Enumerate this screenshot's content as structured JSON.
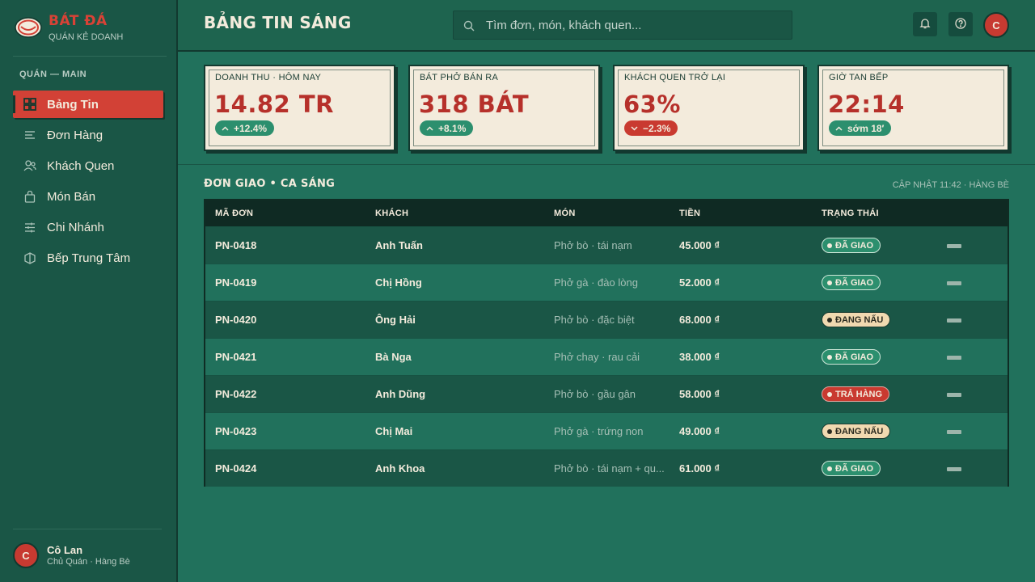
{
  "brand": {
    "name": "BÁT ĐÁ",
    "subtitle": "QUÁN KẺ DOANH"
  },
  "sidebar": {
    "section_label": "QUÁN — MAIN",
    "items": [
      {
        "label": "Bảng Tin",
        "icon": "dashboard-icon",
        "active": true
      },
      {
        "label": "Đơn Hàng",
        "icon": "list-icon",
        "active": false
      },
      {
        "label": "Khách Quen",
        "icon": "users-icon",
        "active": false
      },
      {
        "label": "Món Bán",
        "icon": "bag-icon",
        "active": false
      },
      {
        "label": "Chi Nhánh",
        "icon": "branch-icon",
        "active": false
      },
      {
        "label": "Bếp Trung Tâm",
        "icon": "cube-icon",
        "active": false
      }
    ],
    "user": {
      "initial": "C",
      "name": "Cô Lan",
      "role": "Chủ Quán · Hàng Bè"
    }
  },
  "header": {
    "title": "BẢNG TIN SÁNG",
    "search_placeholder": "Tìm đơn, món, khách quen...",
    "avatar_initial": "C"
  },
  "stats": [
    {
      "label": "DOANH THU · HÔM NAY",
      "value": "14.82 TR",
      "delta": "+12.4%",
      "direction": "up"
    },
    {
      "label": "BÁT PHỞ BÁN RA",
      "value": "318 BÁT",
      "delta": "+8.1%",
      "direction": "up"
    },
    {
      "label": "KHÁCH QUEN TRỞ LẠI",
      "value": "63%",
      "delta": "−2.3%",
      "direction": "down"
    },
    {
      "label": "GIỜ TAN BẾP",
      "value": "22:14",
      "delta": "sớm 18′",
      "direction": "up"
    }
  ],
  "orders": {
    "title": "ĐƠN GIAO • CA SÁNG",
    "meta": "CẬP NHẬT 11:42 · HÀNG BÈ",
    "columns": [
      "MÃ ĐƠN",
      "KHÁCH",
      "MÓN",
      "TIỀN",
      "TRẠNG THÁI"
    ],
    "rows": [
      {
        "id": "PN-0418",
        "customer": "Anh Tuấn",
        "dish": "Phở bò · tái nạm",
        "price": "45.000 ₫",
        "status": "ĐÃ GIAO",
        "status_type": "done"
      },
      {
        "id": "PN-0419",
        "customer": "Chị Hồng",
        "dish": "Phở gà · đào lòng",
        "price": "52.000 ₫",
        "status": "ĐÃ GIAO",
        "status_type": "done"
      },
      {
        "id": "PN-0420",
        "customer": "Ông Hải",
        "dish": "Phở bò · đặc biệt",
        "price": "68.000 ₫",
        "status": "ĐANG NẤU",
        "status_type": "cook"
      },
      {
        "id": "PN-0421",
        "customer": "Bà Nga",
        "dish": "Phở chay · rau cải",
        "price": "38.000 ₫",
        "status": "ĐÃ GIAO",
        "status_type": "done"
      },
      {
        "id": "PN-0422",
        "customer": "Anh Dũng",
        "dish": "Phở bò · gầu gân",
        "price": "58.000 ₫",
        "status": "TRẢ HÀNG",
        "status_type": "return"
      },
      {
        "id": "PN-0423",
        "customer": "Chị Mai",
        "dish": "Phở gà · trứng non",
        "price": "49.000 ₫",
        "status": "ĐANG NẤU",
        "status_type": "cook"
      },
      {
        "id": "PN-0424",
        "customer": "Anh Khoa",
        "dish": "Phở bò · tái nạm + qu...",
        "price": "61.000 ₫",
        "status": "ĐÃ GIAO",
        "status_type": "done"
      }
    ]
  },
  "colors": {
    "accent_red": "#d24136",
    "cream": "#f3ebdc",
    "dark_green": "#12392f",
    "status_done": "#2c8f6e",
    "status_cook": "#f0d9b0",
    "status_return": "#c93a30"
  }
}
